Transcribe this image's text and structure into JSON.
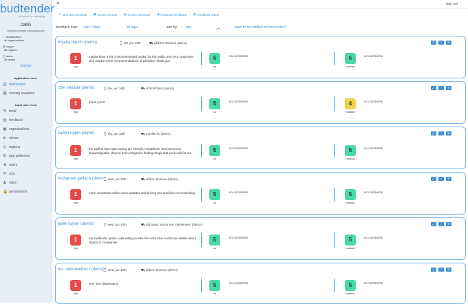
{
  "brand": {
    "logo": "budtender",
    "powered": "powered by springbig"
  },
  "user": {
    "name": "carlo",
    "email": "carlo@example-springbig.com"
  },
  "scope": [
    {
      "icon": "org-icon",
      "glyph": "⌂",
      "label": "organization:",
      "value": "all organizations"
    },
    {
      "icon": "region-icon",
      "glyph": "◍",
      "label": "region:",
      "value": "all regions"
    },
    {
      "icon": "store-icon",
      "glyph": "◫",
      "label": "store:",
      "value": "all stores"
    }
  ],
  "change_label": "change",
  "app_menu": {
    "title": "application menu",
    "items": [
      {
        "key": "dashboard",
        "glyph": "▥",
        "label": "dashboard",
        "active": true
      },
      {
        "key": "scoring-analytics",
        "glyph": "▦",
        "label": "scoring analytics",
        "active": false
      }
    ]
  },
  "super_menu": {
    "title": "super user menu",
    "items": [
      {
        "key": "tools",
        "glyph": "⚒",
        "label": "tools"
      },
      {
        "key": "feedback",
        "glyph": "▤",
        "label": "feedback"
      },
      {
        "key": "organizations",
        "glyph": "▣",
        "label": "organizations"
      },
      {
        "key": "stores",
        "glyph": "◈",
        "label": "stores"
      },
      {
        "key": "regions",
        "glyph": "◎",
        "label": "regions"
      },
      {
        "key": "app-platforms",
        "glyph": "⊞",
        "label": "app platforms"
      },
      {
        "key": "users",
        "glyph": "☻",
        "label": "users"
      },
      {
        "key": "sms",
        "glyph": "✉",
        "label": "sms"
      },
      {
        "key": "roles",
        "glyph": "♟",
        "label": "roles"
      },
      {
        "key": "permissions",
        "glyph": "🔒",
        "label": "permissions"
      }
    ]
  },
  "topbar": {
    "hamburger": "≡",
    "signout": "sign out"
  },
  "tabs": [
    {
      "icon": "send-icon",
      "glyph": "✈",
      "label": "sent and received"
    },
    {
      "icon": "calendar-icon",
      "glyph": "▦",
      "label": "current scores"
    },
    {
      "icon": "chart-icon",
      "glyph": "▥",
      "label": "scores summary"
    },
    {
      "icon": "megaphone-icon",
      "glyph": "◀",
      "label": "important feedback"
    },
    {
      "icon": "report-icon",
      "glyph": "▤",
      "label": "feedback report"
    }
  ],
  "filters": {
    "label": "feedback over",
    "period": "last 7 days",
    "tags": "all tags",
    "sort_label": "sort by:",
    "sort_value": "nps",
    "notify": "want to be notified for low scores?"
  },
  "labels": {
    "nps": "nps",
    "cs": "cs",
    "product": "product",
    "no_comments": "no comments"
  },
  "feedback": [
    {
      "name": "bryana bauch (demo)",
      "date": "sat, jun 18th",
      "store": "(dcbert okuneva (demo)",
      "comment": "maybe have a list of recommended books, for the public and your customers also maybe some recommendations of websites. thank you",
      "nps": "1",
      "nps_color": "red",
      "cs": "5",
      "cs_color": "green",
      "product": "5",
      "product_color": "green"
    },
    {
      "name": "zoie steuber (demo)",
      "date": "thu, jun 16th",
      "store": "schmitt hand (demo)",
      "comment": "thank you!!!",
      "nps": "1",
      "nps_color": "red",
      "cs": "5",
      "cs_color": "green",
      "product": "4",
      "product_color": "yellow"
    },
    {
      "name": "caden rippin (demo)",
      "date": "thu, jun 16th",
      "store": "moeller llc (demo)",
      "comment": "the staff at rose-allan spring are friendly, empathetic, and extremely knowledgeable. they've been integral in finding things that work well for me.",
      "nps": "1",
      "nps_color": "red",
      "cs": "5",
      "cs_color": "green",
      "product": "5",
      "product_color": "green"
    },
    {
      "name": "mohamed gerlach (demo)",
      "date": "wed, jun 15th",
      "store": "dcbert okuneva (demo)",
      "comment": "more consistent online menu updates and pricing and timelines on restocking.",
      "nps": "1",
      "nps_color": "red",
      "cs": "5",
      "cs_color": "green",
      "product": "5",
      "product_color": "green"
    },
    {
      "name": "jewel turner (demo)",
      "date": "wed, jun 15th",
      "store": "dubuque, larson and stiedemann (demo)",
      "comment": "my budtender james, was willing to take the extra time to discuss details about strains or companies.",
      "nps": "1",
      "nps_color": "red",
      "cs": "5",
      "cs_color": "green",
      "product": "5",
      "product_color": "green"
    },
    {
      "name": "ms. odie keebler i (demo)",
      "date": "wed, jun 15th",
      "store": "dcbert okuneva (demo)",
      "comment": "very nice dispensary!!",
      "nps": "1",
      "nps_color": "red",
      "cs": "5",
      "cs_color": "green",
      "product": "5",
      "product_color": "green"
    }
  ]
}
